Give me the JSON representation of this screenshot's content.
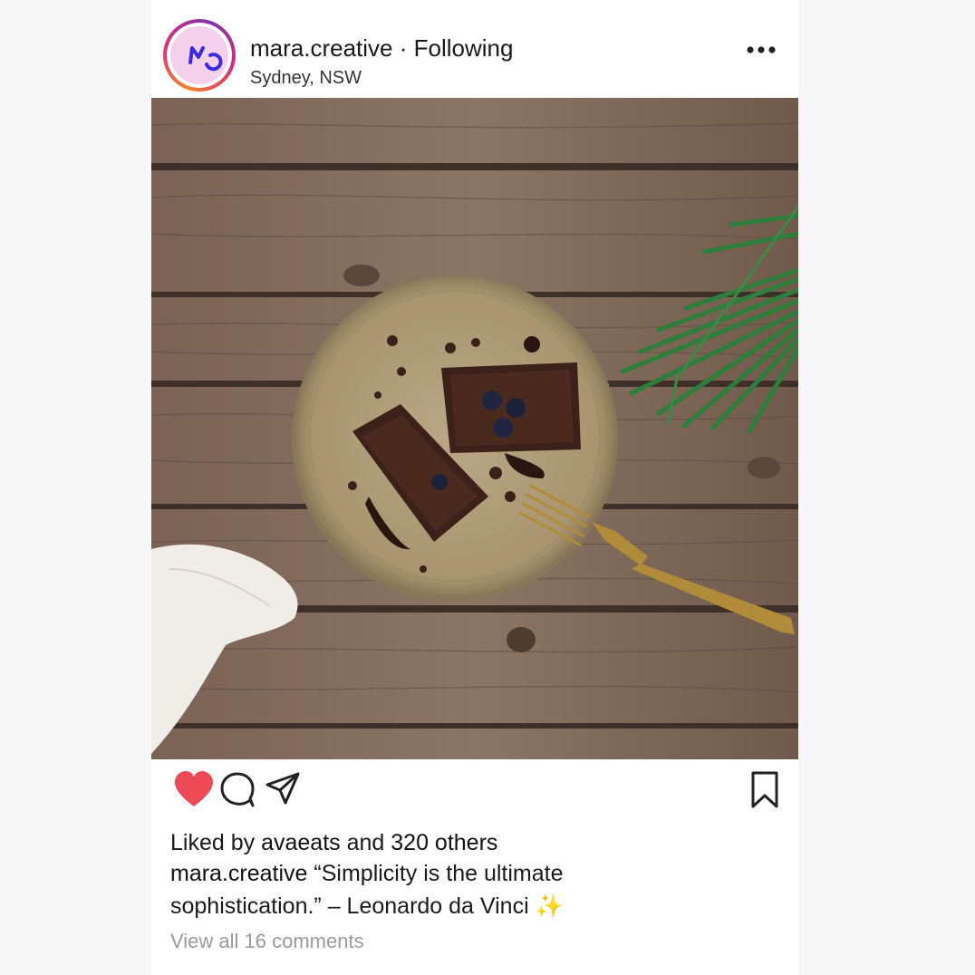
{
  "post": {
    "username": "mara.creative",
    "separator": "·",
    "follow_status": "Following",
    "location": "Sydney, NSW",
    "avatar_initials": "MC",
    "more_icon": "more-dots-icon",
    "photo_description_icon": "food-photo"
  },
  "actions": {
    "like_icon": "heart-icon",
    "like_color": "#ed4956",
    "comment_icon": "comment-icon",
    "share_icon": "send-icon",
    "save_icon": "bookmark-icon"
  },
  "likes": {
    "prefix": "Liked by",
    "liker": "avaeats",
    "conjunction": "and",
    "others": "320 others"
  },
  "caption": {
    "username": "mara.creative",
    "line1": "“Simplicity is the ultimate",
    "line2": "sophistication.” – Leonardo da Vinci",
    "emoji": "✨"
  },
  "comments_link": "View all 16 comments"
}
